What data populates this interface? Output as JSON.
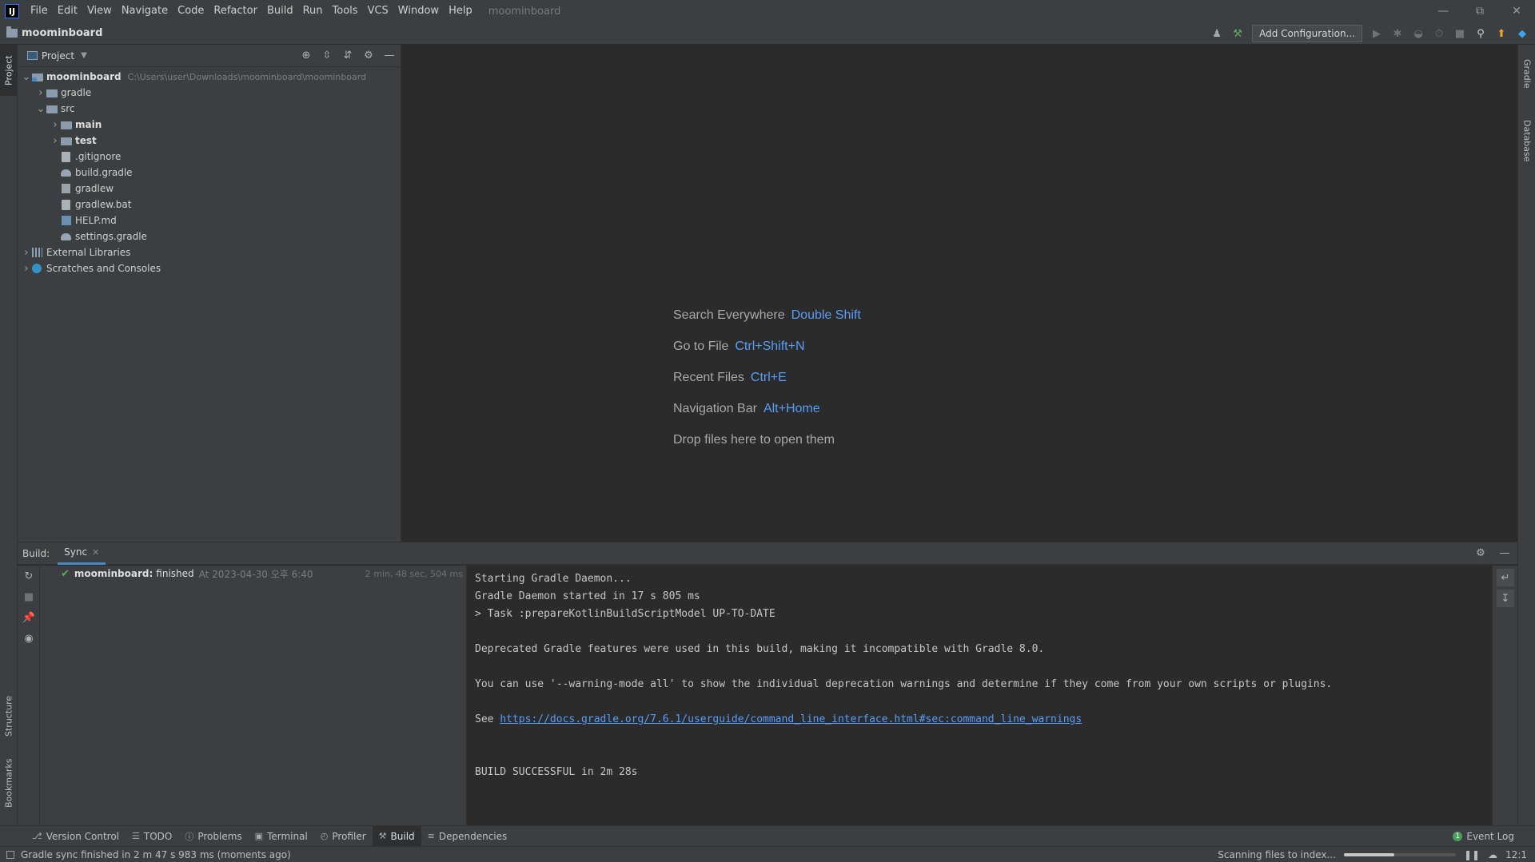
{
  "menubar": {
    "logo": "IJ",
    "items": [
      "File",
      "Edit",
      "View",
      "Navigate",
      "Code",
      "Refactor",
      "Build",
      "Run",
      "Tools",
      "VCS",
      "Window",
      "Help"
    ],
    "window_title": "moominboard"
  },
  "navbar": {
    "breadcrumb": "moominboard",
    "add_configuration": "Add Configuration..."
  },
  "left_strip": {
    "project": "Project",
    "structure": "Structure",
    "bookmarks": "Bookmarks"
  },
  "right_strip": {
    "gradle": "Gradle",
    "database": "Database"
  },
  "project_panel": {
    "title": "Project",
    "tree": [
      {
        "label": "moominboard",
        "path": "C:\\Users\\user\\Downloads\\moominboard\\moominboard",
        "level": 0,
        "expanded": true,
        "icon": "folder-module-icon"
      },
      {
        "label": "gradle",
        "level": 1,
        "expanded": false,
        "icon": "folder-icon"
      },
      {
        "label": "src",
        "level": 1,
        "expanded": true,
        "icon": "folder-icon"
      },
      {
        "label": "main",
        "level": 2,
        "expanded": false,
        "icon": "source-folder-icon"
      },
      {
        "label": "test",
        "level": 2,
        "expanded": false,
        "icon": "source-folder-icon"
      },
      {
        "label": ".gitignore",
        "level": 2,
        "icon": "gitignore-file-icon"
      },
      {
        "label": "build.gradle",
        "level": 2,
        "icon": "gradle-file-icon"
      },
      {
        "label": "gradlew",
        "level": 2,
        "icon": "executable-file-icon"
      },
      {
        "label": "gradlew.bat",
        "level": 2,
        "icon": "batch-file-icon"
      },
      {
        "label": "HELP.md",
        "level": 2,
        "icon": "markdown-file-icon"
      },
      {
        "label": "settings.gradle",
        "level": 2,
        "icon": "gradle-file-icon"
      },
      {
        "label": "External Libraries",
        "level": 0,
        "expanded": false,
        "icon": "library-icon"
      },
      {
        "label": "Scratches and Consoles",
        "level": 0,
        "expanded": false,
        "icon": "scratches-icon"
      }
    ]
  },
  "editor_hints": [
    {
      "text": "Search Everywhere",
      "key": "Double Shift"
    },
    {
      "text": "Go to File",
      "key": "Ctrl+Shift+N"
    },
    {
      "text": "Recent Files",
      "key": "Ctrl+E"
    },
    {
      "text": "Navigation Bar",
      "key": "Alt+Home"
    },
    {
      "text": "Drop files here to open them",
      "key": ""
    }
  ],
  "build": {
    "label": "Build:",
    "tab": "Sync",
    "tree_row": {
      "name": "moominboard:",
      "status": "finished",
      "time": "At 2023-04-30 오후 6:40",
      "duration": "2 min, 48 sec, 504 ms"
    },
    "console": [
      "Starting Gradle Daemon...",
      "Gradle Daemon started in 17 s 805 ms",
      "> Task :prepareKotlinBuildScriptModel UP-TO-DATE",
      "",
      "Deprecated Gradle features were used in this build, making it incompatible with Gradle 8.0.",
      "",
      "You can use '--warning-mode all' to show the individual deprecation warnings and determine if they come from your own scripts or plugins.",
      "",
      "",
      "",
      "BUILD SUCCESSFUL in 2m 28s"
    ],
    "see_prefix": "See ",
    "see_link": "https://docs.gradle.org/7.6.1/userguide/command_line_interface.html#sec:command_line_warnings"
  },
  "toolwindow_tabs": [
    {
      "label": "Version Control",
      "icon": "version-control-icon",
      "active": false
    },
    {
      "label": "TODO",
      "icon": "todo-icon",
      "active": false
    },
    {
      "label": "Problems",
      "icon": "problems-icon",
      "active": false
    },
    {
      "label": "Terminal",
      "icon": "terminal-icon",
      "active": false
    },
    {
      "label": "Profiler",
      "icon": "profiler-icon",
      "active": false
    },
    {
      "label": "Build",
      "icon": "build-icon",
      "active": true
    },
    {
      "label": "Dependencies",
      "icon": "dependencies-icon",
      "active": false
    }
  ],
  "event_log": {
    "badge": "1",
    "label": "Event Log"
  },
  "statusbar": {
    "message": "Gradle sync finished in 2 m 47 s 983 ms (moments ago)",
    "scanning": "Scanning files to index...",
    "progress": 0.45,
    "position": "12:1"
  },
  "colors": {
    "accent": "#4a88c7",
    "link": "#589df6",
    "success": "#5faa5f"
  }
}
